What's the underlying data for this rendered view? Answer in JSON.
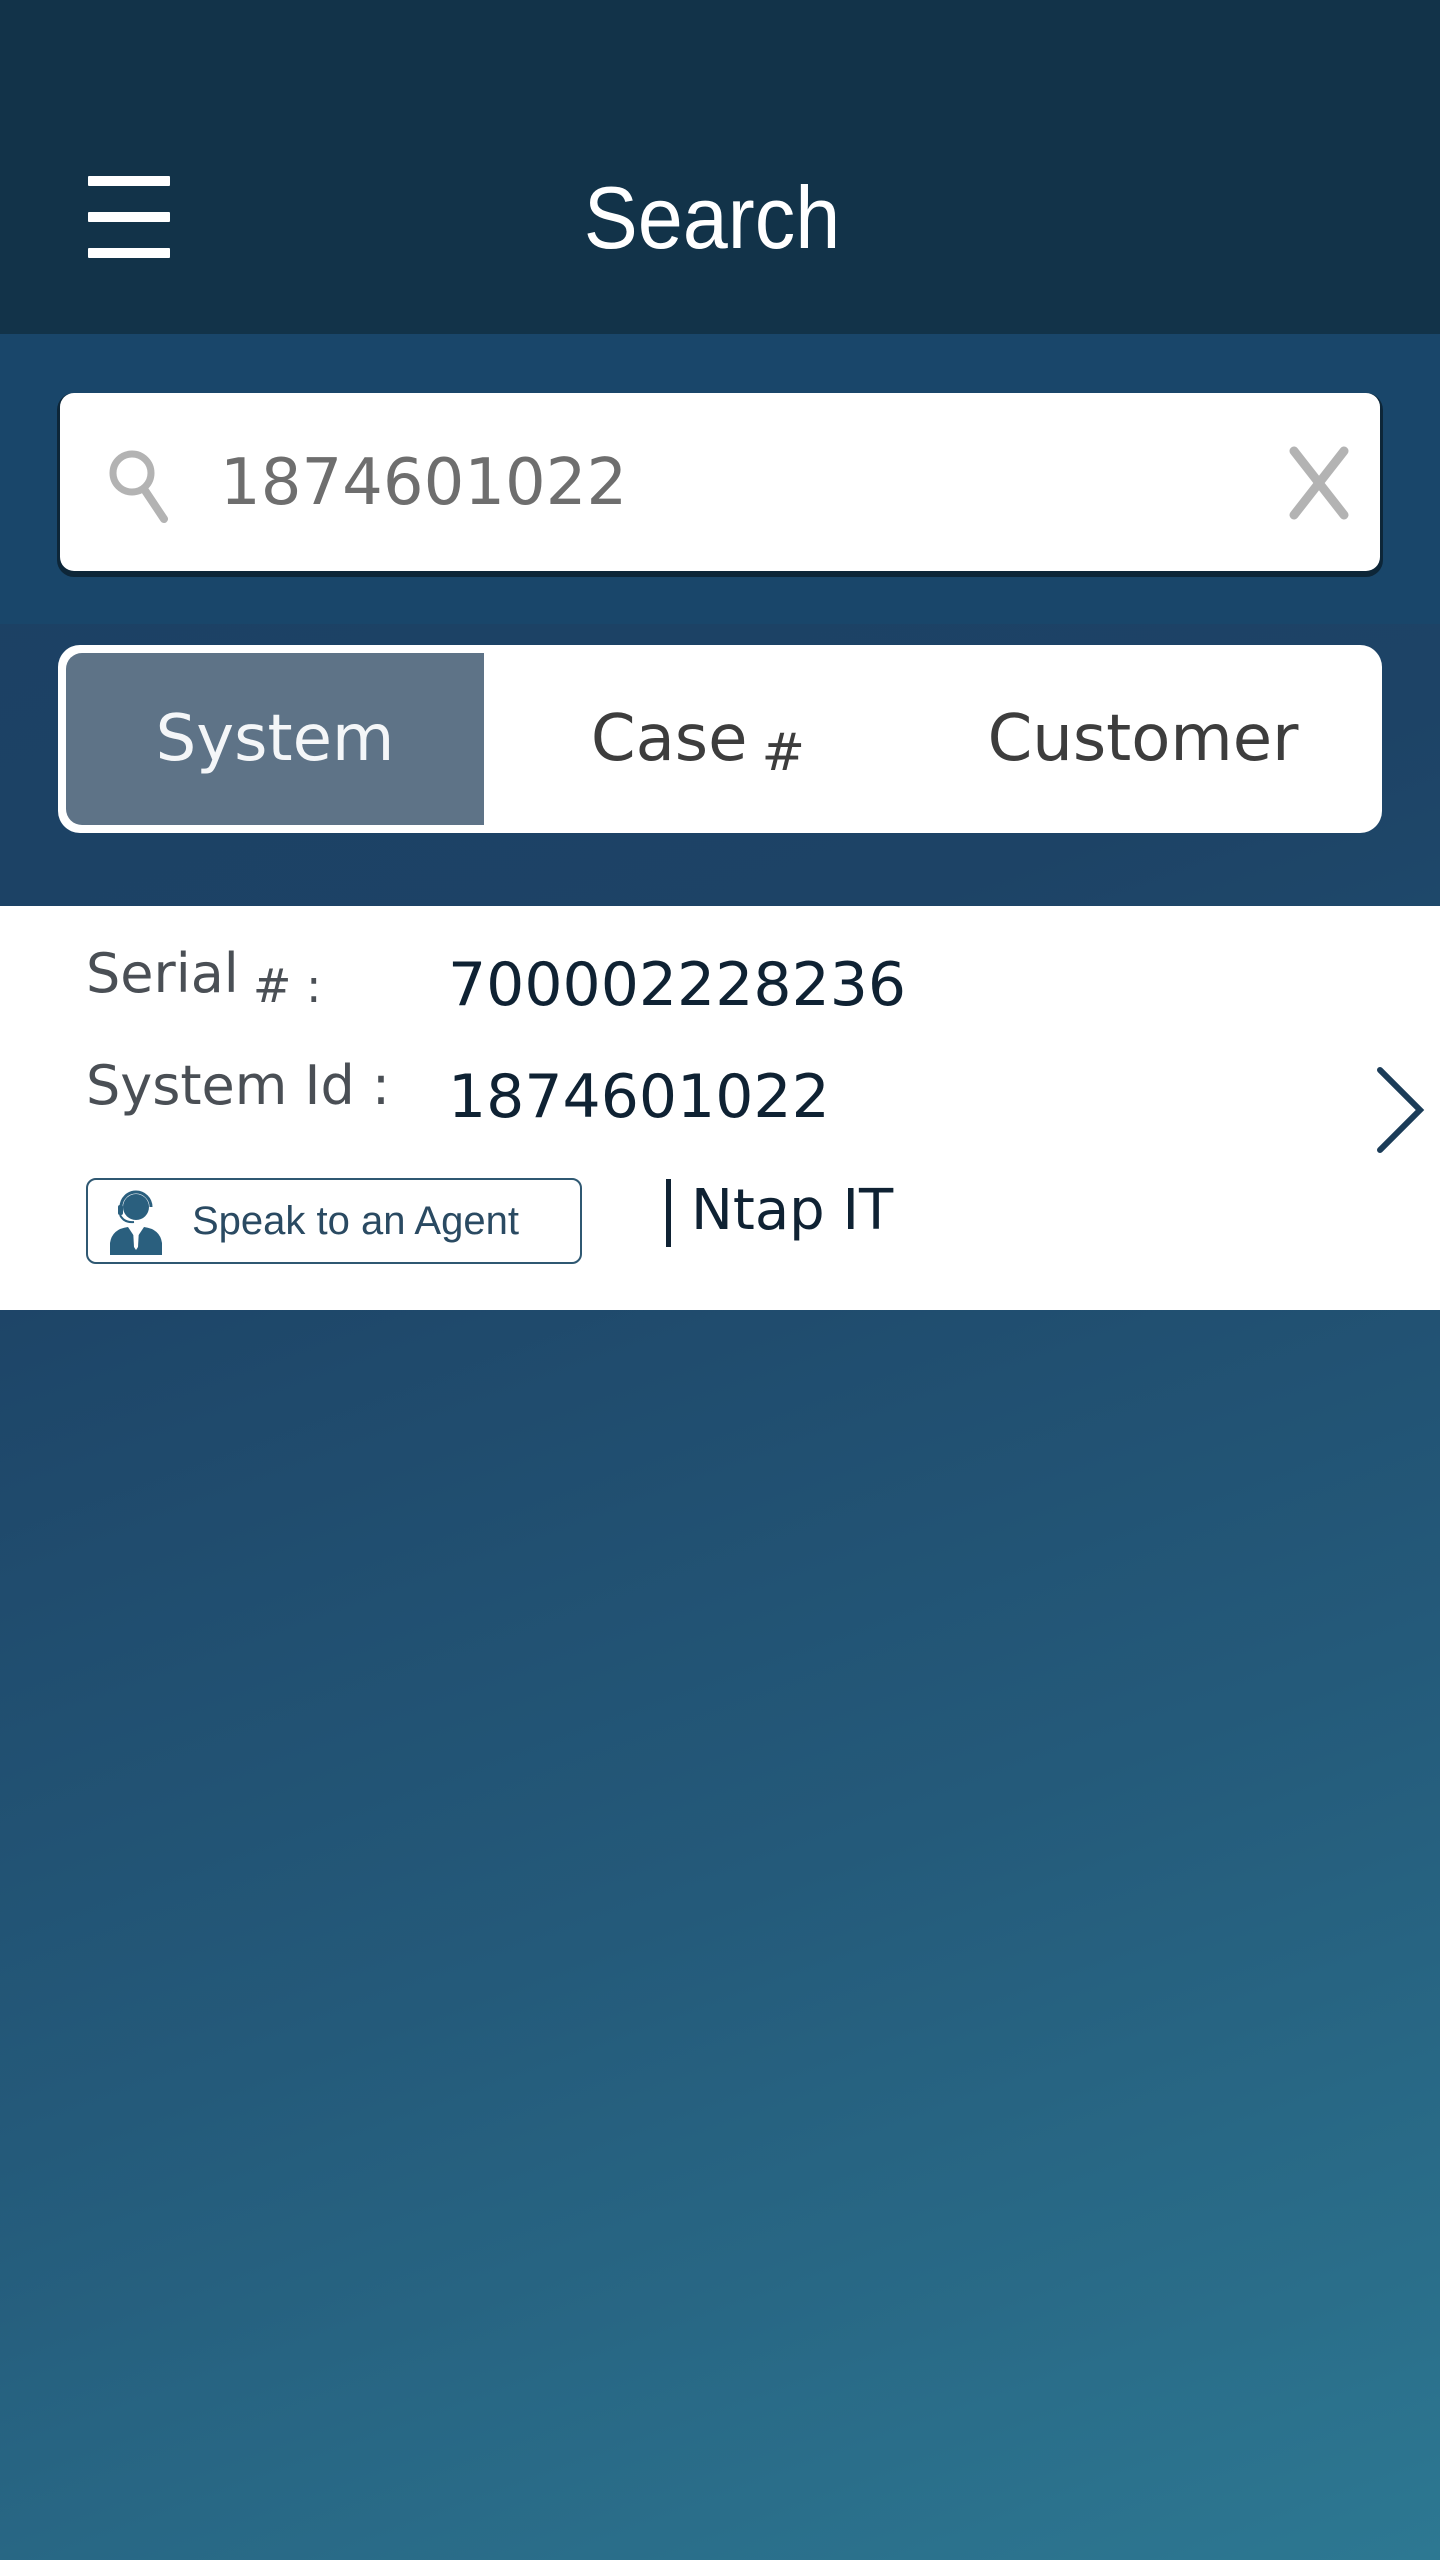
{
  "header": {
    "title": "Search",
    "menu_icon": "hamburger-menu-icon"
  },
  "search": {
    "value": "1874601022",
    "search_icon": "magnifier-icon",
    "clear_icon": "close-x-icon"
  },
  "segments": {
    "selected": "System",
    "items": [
      {
        "label": "System"
      },
      {
        "label": "Case",
        "suffix": "#"
      },
      {
        "label": "Customer"
      }
    ]
  },
  "result": {
    "serial_label": "Serial",
    "serial_suffix": "# :",
    "serial_value": "700002228236",
    "system_id_label": "System Id :",
    "system_id_value": "1874601022",
    "agent_button_label": "Speak to an Agent",
    "agent_icon": "headset-agent-icon",
    "company": "Ntap IT",
    "chevron_icon": "chevron-right-icon"
  },
  "colors": {
    "header_bg": "#123349",
    "search_band_bg": "#19466a",
    "selected_tab_bg": "#5e7387",
    "accent_dark": "#0f2233"
  }
}
